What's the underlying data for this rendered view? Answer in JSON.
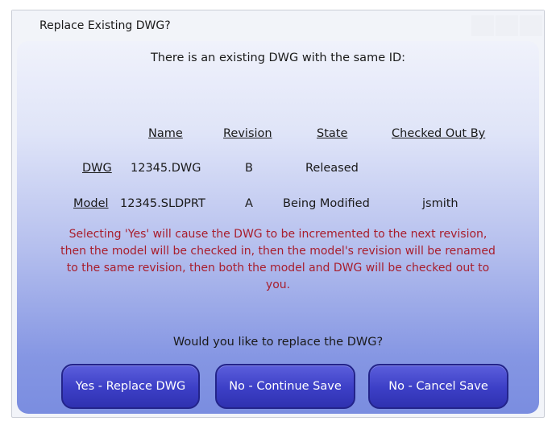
{
  "window": {
    "title": "Replace Existing DWG?"
  },
  "dialog": {
    "intro": "There is an existing DWG with the same ID:",
    "table": {
      "headers": [
        "Name",
        "Revision",
        "State",
        "Checked Out By"
      ],
      "rows": [
        {
          "label": "DWG",
          "name": "12345.DWG",
          "revision": "B",
          "state": "Released",
          "checked_out_by": ""
        },
        {
          "label": "Model",
          "name": "12345.SLDPRT",
          "revision": "A",
          "state": "Being Modified",
          "checked_out_by": "jsmith"
        }
      ]
    },
    "warning_lines": [
      "Selecting 'Yes' will cause the DWG to be incremented to the next revision,",
      "then the model will be checked in, then the model's revision will be renamed",
      "to the same revision, then both the model and DWG will be checked out to",
      "you."
    ],
    "question": "Would you like to replace the DWG?",
    "buttons": {
      "yes": "Yes - Replace DWG",
      "continue": "No - Continue Save",
      "cancel": "No - Cancel Save"
    }
  },
  "colors": {
    "warning_text": "#a81e2d",
    "button_fill": "#3c3fc6",
    "button_border": "#23248a"
  }
}
